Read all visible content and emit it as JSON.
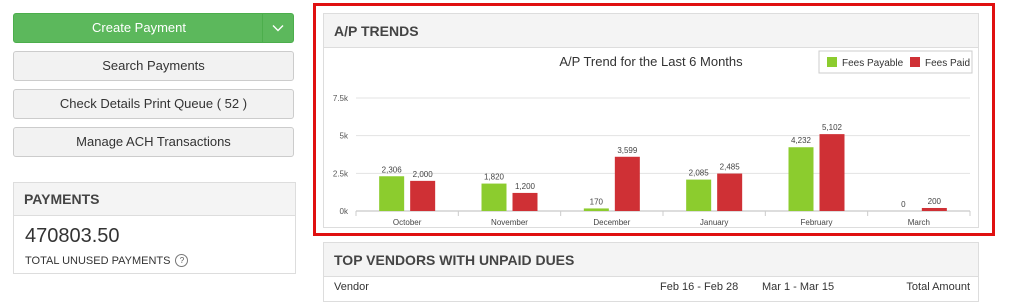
{
  "actions": {
    "create_payment": "Create Payment",
    "search_payments": "Search Payments",
    "print_queue": "Check Details Print Queue ( 52 )",
    "manage_ach": "Manage ACH Transactions"
  },
  "payments": {
    "title": "PAYMENTS",
    "amount": "470803.50",
    "caption": "TOTAL UNUSED PAYMENTS"
  },
  "ap_trends": {
    "header": "A/P TRENDS"
  },
  "chart_data": {
    "type": "bar",
    "title": "A/P Trend for the Last 6 Months",
    "categories": [
      "October",
      "November",
      "December",
      "January",
      "February",
      "March"
    ],
    "series": [
      {
        "name": "Fees Payable",
        "color": "#8ccc2e",
        "values": [
          2306,
          1820,
          170,
          2085,
          4232,
          0
        ],
        "labels": [
          "2,306",
          "1,820",
          "170",
          "2,085",
          "4,232",
          "0"
        ]
      },
      {
        "name": "Fees Paid",
        "color": "#cf3035",
        "values": [
          2000,
          1200,
          3599,
          2485,
          5102,
          200
        ],
        "labels": [
          "2,000",
          "1,200",
          "3,599",
          "2,485",
          "5,102",
          "200"
        ]
      }
    ],
    "yticks": [
      {
        "value": 0,
        "label": "0k"
      },
      {
        "value": 2500,
        "label": "2.5k"
      },
      {
        "value": 5000,
        "label": "5k"
      },
      {
        "value": 7500,
        "label": "7.5k"
      }
    ],
    "ylim": [
      0,
      7500
    ],
    "grid": true,
    "legend": "top-right"
  },
  "vendors": {
    "title": "TOP VENDORS WITH UNPAID DUES",
    "columns": [
      "Vendor",
      "Feb 16 - Feb 28",
      "Mar 1 - Mar 15",
      "Total Amount"
    ]
  }
}
